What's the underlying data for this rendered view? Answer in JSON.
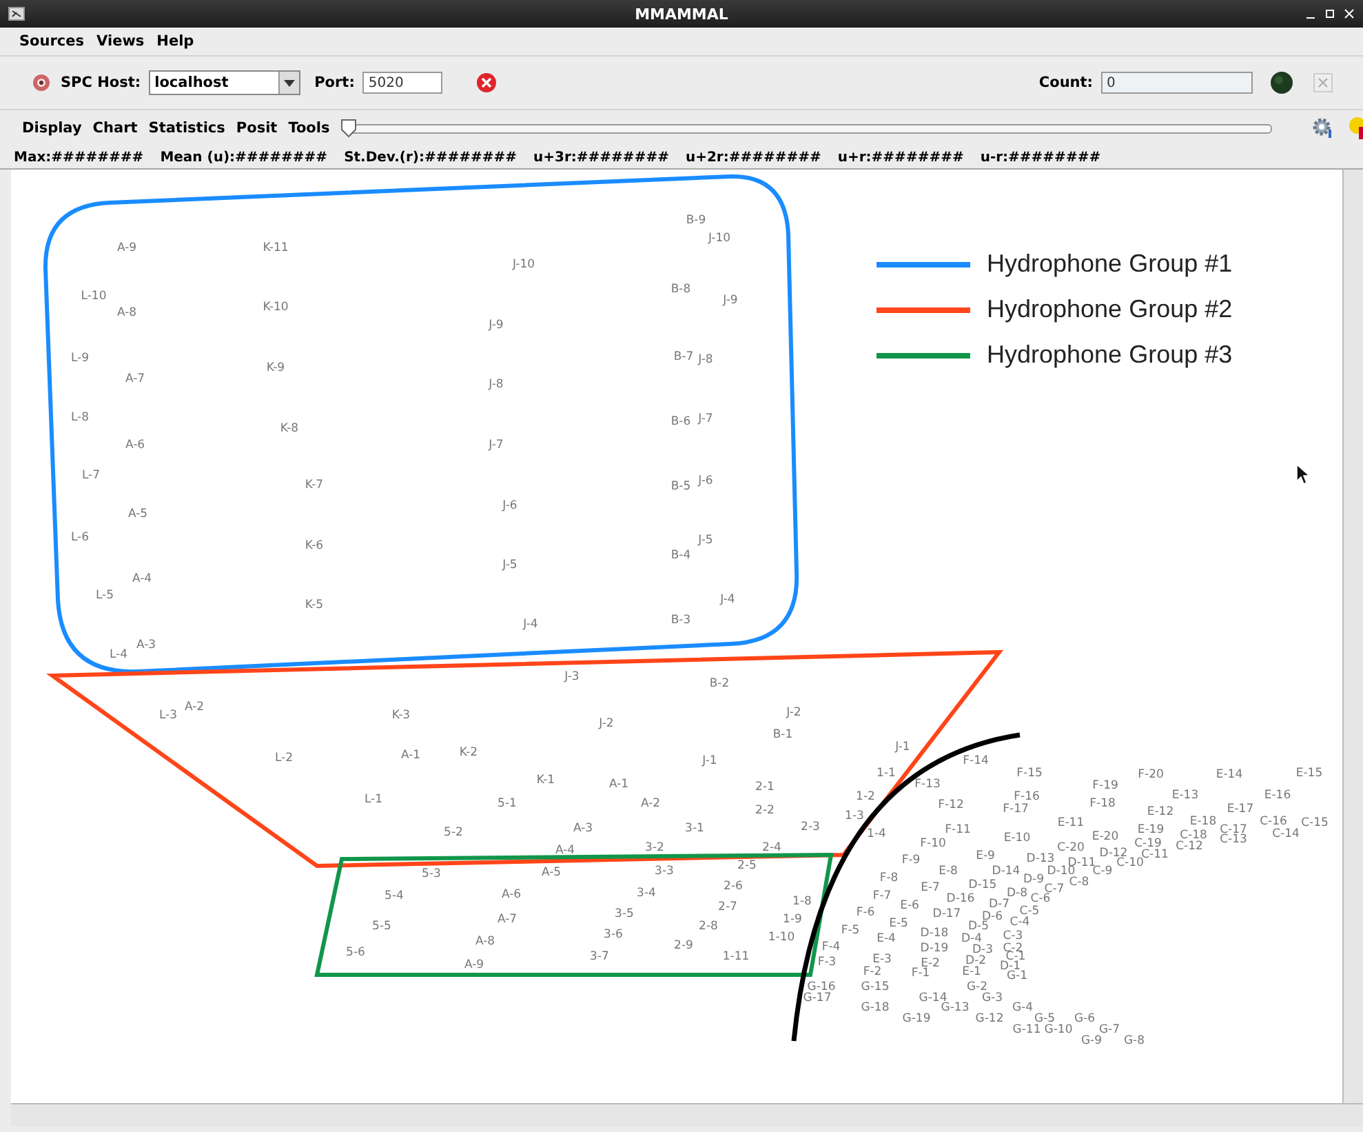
{
  "window": {
    "title": "MMAMMAL"
  },
  "menu": [
    "Sources",
    "Views",
    "Help"
  ],
  "connection": {
    "host_label": "SPC Host:",
    "host": "localhost",
    "port_label": "Port:",
    "port": "5020",
    "count_label": "Count:",
    "count": "0"
  },
  "view_menu": [
    "Display",
    "Chart",
    "Statistics",
    "Posit",
    "Tools"
  ],
  "slider": {
    "level": 0
  },
  "stats": [
    "Max:########",
    "Mean (u):########",
    "St.Dev.(r):########",
    "u+3r:########",
    "u+2r:########",
    "u+r:########",
    "u-r:########"
  ],
  "legend": [
    {
      "label": "Hydrophone Group #1",
      "color": "#1a8cff"
    },
    {
      "label": "Hydrophone Group #2",
      "color": "#ff4519"
    },
    {
      "label": "Hydrophone Group #3",
      "color": "#11964a"
    }
  ],
  "markers": [
    "A-9",
    "K-11",
    "L-10",
    "A-8",
    "K-10",
    "L-9",
    "A-7",
    "K-9",
    "L-8",
    "K-8",
    "A-6",
    "L-7",
    "K-7",
    "A-5",
    "L-6",
    "K-6",
    "A-4",
    "L-5",
    "K-5",
    "L-4",
    "A-3",
    "B-9",
    "J-10",
    "J-10",
    "B-8",
    "J-9",
    "J-9",
    "B-7",
    "J-8",
    "J-8",
    "B-6",
    "J-7",
    "J-7",
    "B-5",
    "J-6",
    "J-6",
    "J-5",
    "B-4",
    "J-5",
    "J-4",
    "B-3",
    "J-4",
    "J-3",
    "B-2",
    "L-3",
    "A-2",
    "K-3",
    "J-2",
    "J-2",
    "B-1",
    "L-2",
    "A-1",
    "K-2",
    "J-1",
    "K-1",
    "A-1",
    "2-1",
    "L-1",
    "5-1",
    "A-2",
    "2-2",
    "5-2",
    "A-3",
    "3-1",
    "2-3",
    "A-4",
    "3-2",
    "2-4",
    "5-3",
    "A-5",
    "3-3",
    "2-5",
    "5-4",
    "A-6",
    "3-4",
    "2-6",
    "1-8",
    "5-5",
    "A-7",
    "3-5",
    "2-7",
    "1-9",
    "5-6",
    "A-8",
    "3-6",
    "2-8",
    "1-10",
    "A-9",
    "3-7",
    "2-9",
    "1-11",
    "J-1",
    "F-14",
    "1-1",
    "F-15",
    "F-20",
    "E-14",
    "E-15",
    "1-2",
    "F-13",
    "F-16",
    "F-19",
    "E-13",
    "E-16",
    "F-12",
    "F-17",
    "F-18",
    "E-12",
    "E-17",
    "1-3",
    "E-11",
    "E-18",
    "C-16",
    "C-15",
    "1-4",
    "F-11",
    "E-19",
    "C-18",
    "C-17",
    "C-14",
    "F-10",
    "E-10",
    "C-20",
    "E-20",
    "C-19",
    "C-12",
    "C-13",
    "D-12",
    "C-11",
    "F-9",
    "E-9",
    "D-13",
    "D-11",
    "C-10",
    "F-8",
    "E-8",
    "D-14",
    "D-10",
    "C-9",
    "E-7",
    "D-15",
    "D-9",
    "C-8",
    "F-7",
    "D-8",
    "C-7",
    "E-6",
    "D-16",
    "D-7",
    "C-6",
    "F-6",
    "D-17",
    "D-6",
    "C-5",
    "E-5",
    "D-5",
    "C-4",
    "F-5",
    "E-4",
    "D-18",
    "D-4",
    "C-3",
    "F-4",
    "D-19",
    "D-3",
    "C-2",
    "F-3",
    "E-3",
    "D-2",
    "C-1",
    "E-2",
    "D-1",
    "F-2",
    "F-1",
    "E-1",
    "G-1",
    "G-16",
    "G-15",
    "G-2",
    "G-17",
    "G-14",
    "G-3",
    "G-18",
    "G-13",
    "G-4",
    "G-19",
    "G-12",
    "G-5",
    "G-6",
    "G-11",
    "G-10",
    "G-7",
    "G-9",
    "G-8"
  ]
}
